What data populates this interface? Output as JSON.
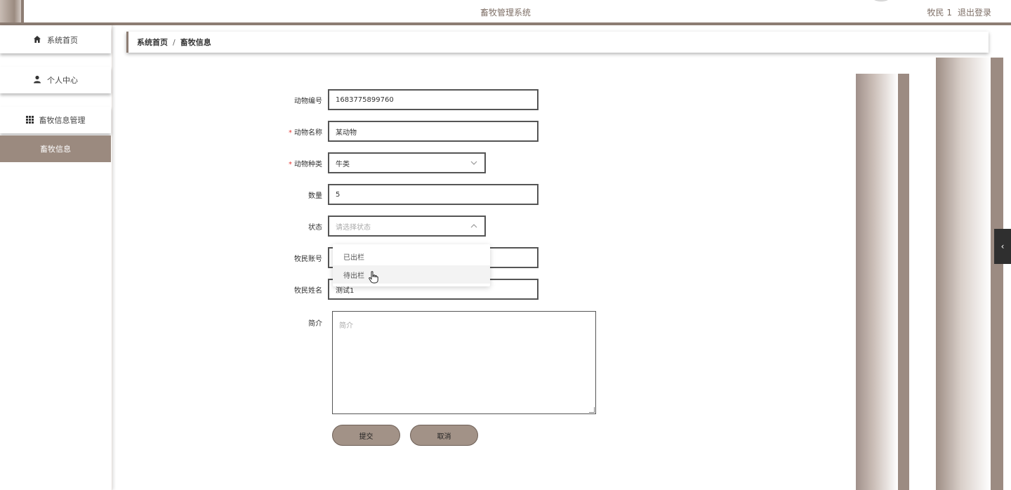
{
  "header": {
    "title": "畜牧管理系统",
    "user": "牧民 1",
    "logout": "退出登录"
  },
  "sidebar": {
    "items": [
      {
        "label": "系统首页",
        "icon": "home-icon"
      },
      {
        "label": "个人中心",
        "icon": "user-icon"
      },
      {
        "label": "畜牧信息管理",
        "icon": "grid-icon"
      }
    ],
    "active_sub": "畜牧信息"
  },
  "breadcrumb": {
    "home": "系统首页",
    "separator": "/",
    "current": "畜牧信息"
  },
  "form": {
    "animal_id": {
      "label": "动物编号",
      "value": "1683775899760"
    },
    "animal_name": {
      "label": "动物名称",
      "value": "某动物",
      "required": true
    },
    "animal_type": {
      "label": "动物种类",
      "value": "牛类",
      "required": true
    },
    "quantity": {
      "label": "数量",
      "value": "5"
    },
    "status": {
      "label": "状态",
      "placeholder": "请选择状态",
      "options": [
        "已出栏",
        "待出栏"
      ]
    },
    "herder_account": {
      "label": "牧民账号",
      "value": ""
    },
    "herder_name": {
      "label": "牧民姓名",
      "value": "测试1"
    },
    "intro": {
      "label": "简介",
      "placeholder": "简介"
    },
    "required_mark": "*",
    "submit": "提交",
    "cancel": "取消"
  },
  "colors": {
    "accent": "#9b8a7f",
    "border": "#555555"
  }
}
